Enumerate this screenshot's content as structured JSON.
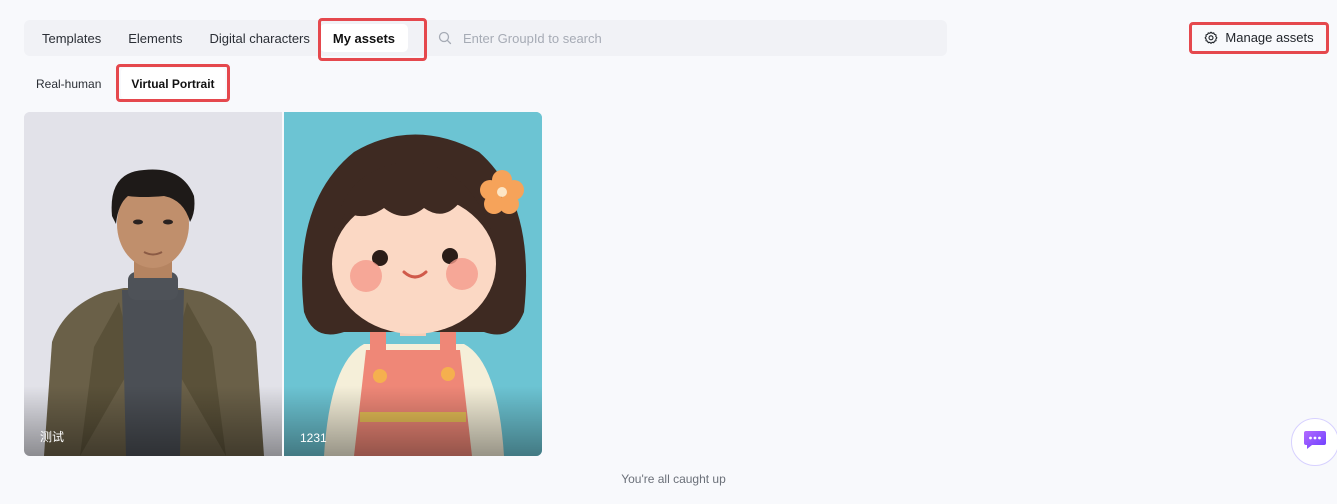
{
  "tabs": {
    "templates": "Templates",
    "elements": "Elements",
    "digital_characters": "Digital characters",
    "my_assets": "My assets"
  },
  "search": {
    "placeholder": "Enter GroupId to search"
  },
  "manage_assets": {
    "label": "Manage assets",
    "icon": "gear-icon"
  },
  "subtabs": {
    "real_human": "Real-human",
    "virtual_portrait": "Virtual Portrait"
  },
  "assets": [
    {
      "name": "测试",
      "kind": "real-human-photo"
    },
    {
      "name": "1231",
      "kind": "cartoon-girl-illustration"
    }
  ],
  "footer": {
    "caught_up": "You're all caught up"
  },
  "colors": {
    "highlight": "#e5484d",
    "chat_accent": "#8a4dff"
  }
}
